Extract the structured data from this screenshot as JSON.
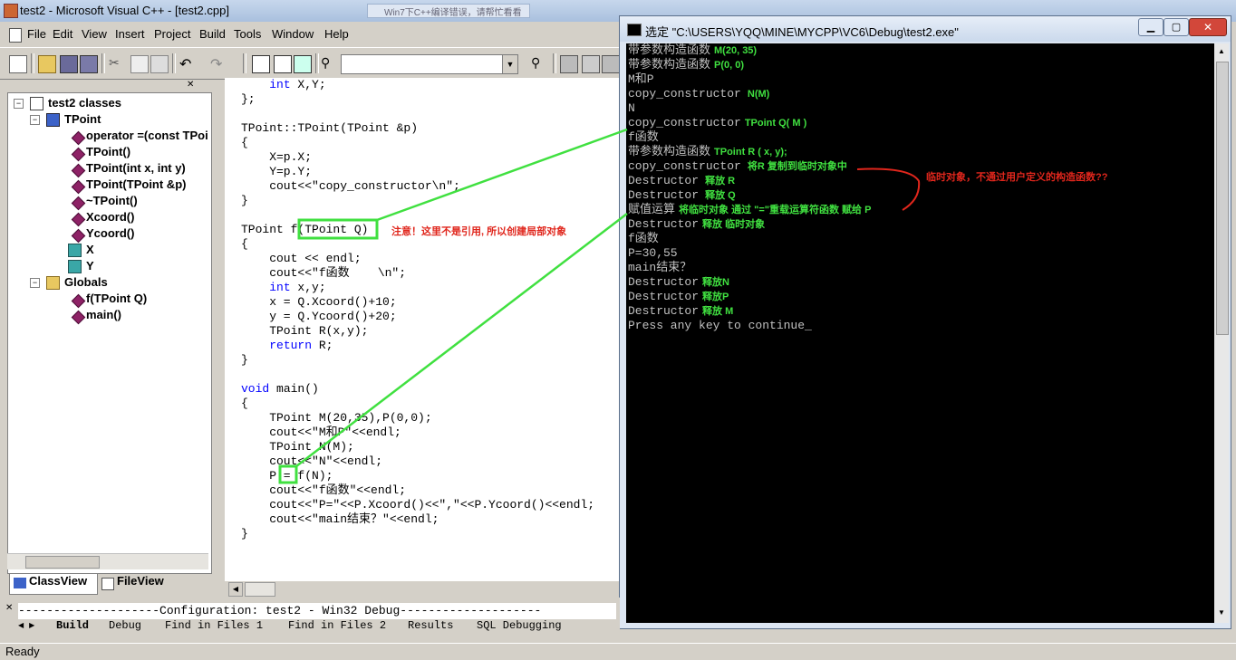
{
  "window": {
    "title": "test2 - Microsoft Visual C++ - [test2.cpp]",
    "taskbar_hint": "Win7下C++编译错误，请帮忙看看"
  },
  "menu": [
    "File",
    "Edit",
    "View",
    "Insert",
    "Project",
    "Build",
    "Tools",
    "Window",
    "Help"
  ],
  "classview": {
    "root": "test2 classes",
    "class": "TPoint",
    "members": [
      "operator =(const TPoi",
      "TPoint()",
      "TPoint(int x, int y)",
      "TPoint(TPoint &p)",
      "~TPoint()",
      "Xcoord()",
      "Ycoord()"
    ],
    "fields": [
      "X",
      "Y"
    ],
    "globals_label": "Globals",
    "globals": [
      "f(TPoint Q)",
      "main()"
    ],
    "tab_classview": "ClassView",
    "tab_fileview": "FileView"
  },
  "code": {
    "lines": [
      "    int X,Y;",
      "};",
      "",
      "TPoint::TPoint(TPoint &p)",
      "{",
      "    X=p.X;",
      "    Y=p.Y;",
      "    cout<<\"copy_constructor\\n\";",
      "}",
      "",
      "TPoint f(TPoint Q)",
      "{",
      "    cout << endl;",
      "    cout<<\"f函数    \\n\";",
      "    int x,y;",
      "    x = Q.Xcoord()+10;",
      "    y = Q.Ycoord()+20;",
      "    TPoint R(x,y);",
      "    return R;",
      "}",
      "",
      "void main()",
      "{",
      "    TPoint M(20,35),P(0,0);",
      "    cout<<\"M和P\"<<endl;",
      "    TPoint N(M);",
      "    cout<<\"N\"<<endl;",
      "    P = f(N);",
      "    cout<<\"f函数\"<<endl;",
      "    cout<<\"P=\"<<P.Xcoord()<<\",\"<<P.Ycoord()<<endl;",
      "    cout<<\"main结束？\"<<endl;",
      "}"
    ],
    "note": "注意！这里不是引用, 所以创建局部对象"
  },
  "console": {
    "title": "选定 \"C:\\USERS\\YQQ\\MINE\\MYCPP\\VC6\\Debug\\test2.exe\"",
    "lines": [
      {
        "text": "带参数构造函数",
        "note": "M(20, 35)"
      },
      {
        "text": "带参数构造函数",
        "note": "P(0, 0)"
      },
      {
        "text": "M和P",
        "note": ""
      },
      {
        "text": "copy_constructor",
        "note": " N(M)"
      },
      {
        "text": "N",
        "note": ""
      },
      {
        "text": "copy_constructor",
        "note": "TPoint Q( M )"
      },
      {
        "text": "f函数",
        "note": ""
      },
      {
        "text": "带参数构造函数",
        "note": "TPoint R ( x, y);"
      },
      {
        "text": "copy_constructor",
        "note": " 将R 复制到临时对象中"
      },
      {
        "text": "Destructor",
        "note": " 释放 R"
      },
      {
        "text": "Destructor",
        "note": " 释放 Q"
      },
      {
        "text": "赋值运算",
        "note": "将临时对象 通过 \"=\"重载运算符函数 赋给 P"
      },
      {
        "text": "Destructor",
        "note": "释放 临时对象"
      },
      {
        "text": "f函数",
        "note": ""
      },
      {
        "text": "P=30,55",
        "note": ""
      },
      {
        "text": "main结束？",
        "note": ""
      },
      {
        "text": "Destructor",
        "note": "释放N"
      },
      {
        "text": "Destructor",
        "note": "释放P"
      },
      {
        "text": "Destructor",
        "note": "释放 M"
      },
      {
        "text": "Press any key to continue",
        "note": ""
      }
    ],
    "temp_note": "临时对象，不通过用户定义的构造函数??"
  },
  "output": {
    "config_line": "--------------------Configuration: test2 - Win32 Debug--------------------",
    "tabs": [
      "Build",
      "Debug",
      "Find in Files 1",
      "Find in Files 2",
      "Results",
      "SQL Debugging"
    ]
  },
  "status": "Ready",
  "colors": {
    "annotation_green": "#40e040",
    "annotation_red": "#e0261c",
    "keyword_blue": "#0000ff"
  }
}
